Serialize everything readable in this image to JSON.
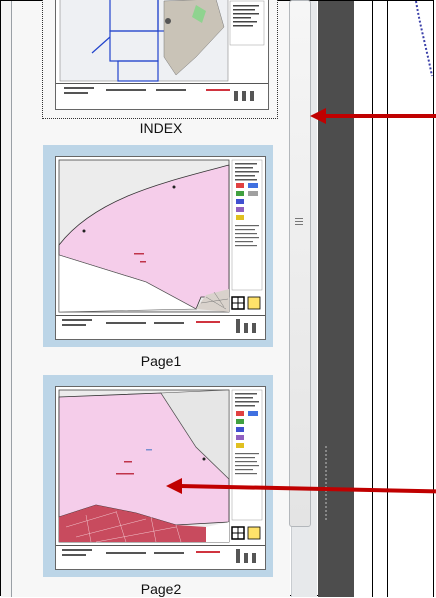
{
  "thumbnails": [
    {
      "label": "INDEX",
      "selected": false
    },
    {
      "label": "Page1",
      "selected": true
    },
    {
      "label": "Page2",
      "selected": true
    }
  ],
  "colors": {
    "selection": "#bcd5e7",
    "map_pink": "#f5cdea",
    "arrow": "#c00000",
    "divider": "#4d4d4d"
  }
}
